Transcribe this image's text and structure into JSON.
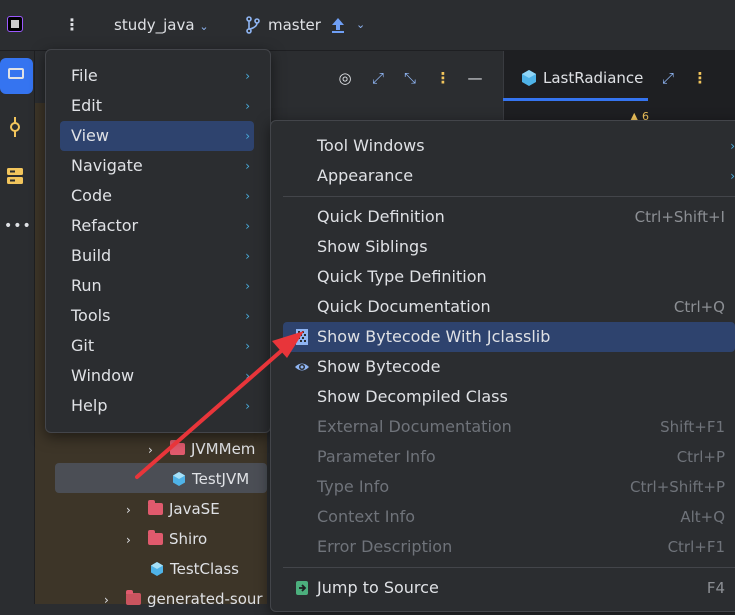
{
  "topbar": {
    "project": "study_java",
    "branch": "master"
  },
  "editor": {
    "tab_label": "LastRadiance",
    "gutter_text": "6"
  },
  "tree": {
    "rows": [
      {
        "label": "JVMMem",
        "kind": "folder",
        "expander": true
      },
      {
        "label": "TestJVM",
        "kind": "class",
        "expander": false,
        "selected": true
      },
      {
        "label": "JavaSE",
        "kind": "folder",
        "expander": true
      },
      {
        "label": "Shiro",
        "kind": "folder",
        "expander": true
      },
      {
        "label": "TestClass",
        "kind": "class",
        "expander": false
      },
      {
        "label": "generated-sour",
        "kind": "folder",
        "expander": true
      }
    ]
  },
  "main_menu": {
    "items": [
      {
        "label": "File"
      },
      {
        "label": "Edit"
      },
      {
        "label": "View",
        "selected": true
      },
      {
        "label": "Navigate"
      },
      {
        "label": "Code"
      },
      {
        "label": "Refactor"
      },
      {
        "label": "Build"
      },
      {
        "label": "Run"
      },
      {
        "label": "Tools"
      },
      {
        "label": "Git"
      },
      {
        "label": "Window"
      },
      {
        "label": "Help"
      }
    ]
  },
  "view_menu": {
    "group1": [
      {
        "label": "Tool Windows",
        "submenu": true
      },
      {
        "label": "Appearance",
        "submenu": true
      }
    ],
    "group2": [
      {
        "label": "Quick Definition",
        "shortcut": "Ctrl+Shift+I"
      },
      {
        "label": "Show Siblings",
        "shortcut": ""
      },
      {
        "label": "Quick Type Definition",
        "shortcut": ""
      },
      {
        "label": "Quick Documentation",
        "shortcut": "Ctrl+Q"
      },
      {
        "label": "Show Bytecode With Jclasslib",
        "shortcut": "",
        "icon": "bytecode-icon",
        "selected": true
      },
      {
        "label": "Show Bytecode",
        "shortcut": "",
        "icon": "eye-icon"
      },
      {
        "label": "Show Decompiled Class",
        "shortcut": ""
      },
      {
        "label": "External Documentation",
        "shortcut": "Shift+F1",
        "disabled": true
      },
      {
        "label": "Parameter Info",
        "shortcut": "Ctrl+P",
        "disabled": true
      },
      {
        "label": "Type Info",
        "shortcut": "Ctrl+Shift+P",
        "disabled": true
      },
      {
        "label": "Context Info",
        "shortcut": "Alt+Q",
        "disabled": true
      },
      {
        "label": "Error Description",
        "shortcut": "Ctrl+F1",
        "disabled": true
      }
    ],
    "group3": [
      {
        "label": "Jump to Source",
        "shortcut": "F4",
        "icon": "jump-source-icon"
      }
    ]
  },
  "colors": {
    "accent": "#3574f0",
    "selection": "#2e436e",
    "annotation_arrow": "#e8353a"
  }
}
